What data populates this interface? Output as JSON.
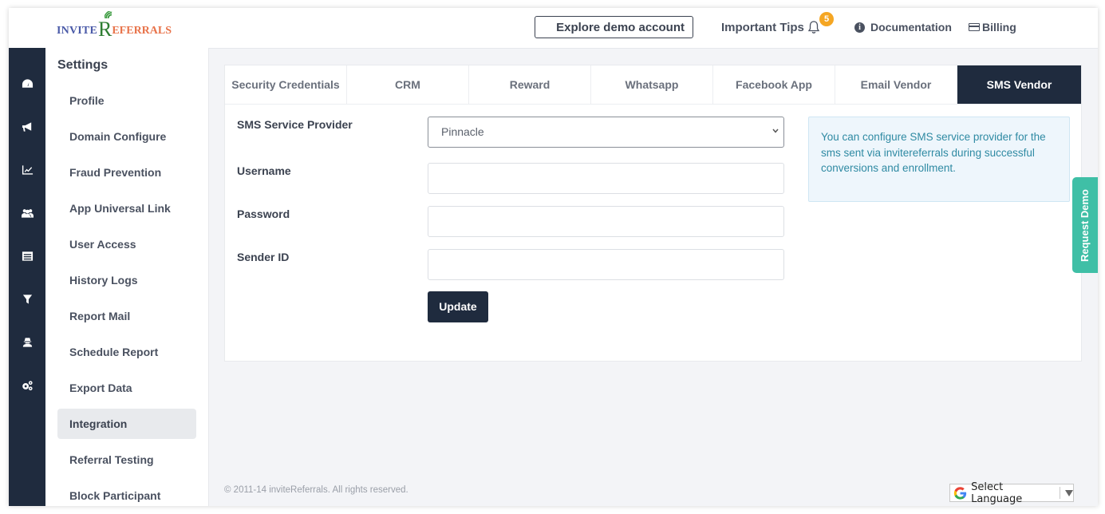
{
  "brand": {
    "logo_invite": "INVITE",
    "logo_r": "R",
    "logo_eferrals": "EFERRALS"
  },
  "header": {
    "explore_label": "Explore demo account",
    "tips_label": "Important Tips",
    "tips_badge": "5",
    "docs_label": "Documentation",
    "billing_label": "Billing"
  },
  "rail": [
    {
      "icon": "dashboard-icon"
    },
    {
      "icon": "megaphone-icon"
    },
    {
      "icon": "chart-line-icon"
    },
    {
      "icon": "users-icon"
    },
    {
      "icon": "list-icon"
    },
    {
      "icon": "filter-icon"
    },
    {
      "icon": "user-secret-icon"
    },
    {
      "icon": "cogs-icon"
    }
  ],
  "settings": {
    "title": "Settings",
    "items": [
      {
        "label": "Profile"
      },
      {
        "label": "Domain Configure"
      },
      {
        "label": "Fraud Prevention"
      },
      {
        "label": "App Universal Link"
      },
      {
        "label": "User Access"
      },
      {
        "label": "History Logs"
      },
      {
        "label": "Report Mail"
      },
      {
        "label": "Schedule Report"
      },
      {
        "label": "Export Data"
      },
      {
        "label": "Integration",
        "active": true
      },
      {
        "label": "Referral Testing"
      },
      {
        "label": "Block Participant"
      }
    ]
  },
  "tabs": [
    {
      "label": "Security Credentials"
    },
    {
      "label": "CRM"
    },
    {
      "label": "Reward"
    },
    {
      "label": "Whatsapp"
    },
    {
      "label": "Facebook App"
    },
    {
      "label": "Email Vendor"
    },
    {
      "label": "SMS Vendor",
      "active": true
    }
  ],
  "form": {
    "provider_label": "SMS Service Provider",
    "provider_value": "Pinnacle",
    "username_label": "Username",
    "username_value": "",
    "password_label": "Password",
    "password_value": "",
    "sender_label": "Sender ID",
    "sender_value": "",
    "update_label": "Update"
  },
  "info": {
    "text": "You can configure SMS service provider for the sms sent via invitereferrals during successful conversions and enrollment."
  },
  "request_demo_label": "Request Demo",
  "footer": {
    "copyright": "© 2011-14 inviteReferrals. All rights reserved."
  },
  "language": {
    "label": "Select Language"
  },
  "colors": {
    "navy": "#1f2b3e",
    "accent_teal": "#3fbfa6",
    "badge": "#f5a623",
    "info_text": "#2f8aa3"
  }
}
